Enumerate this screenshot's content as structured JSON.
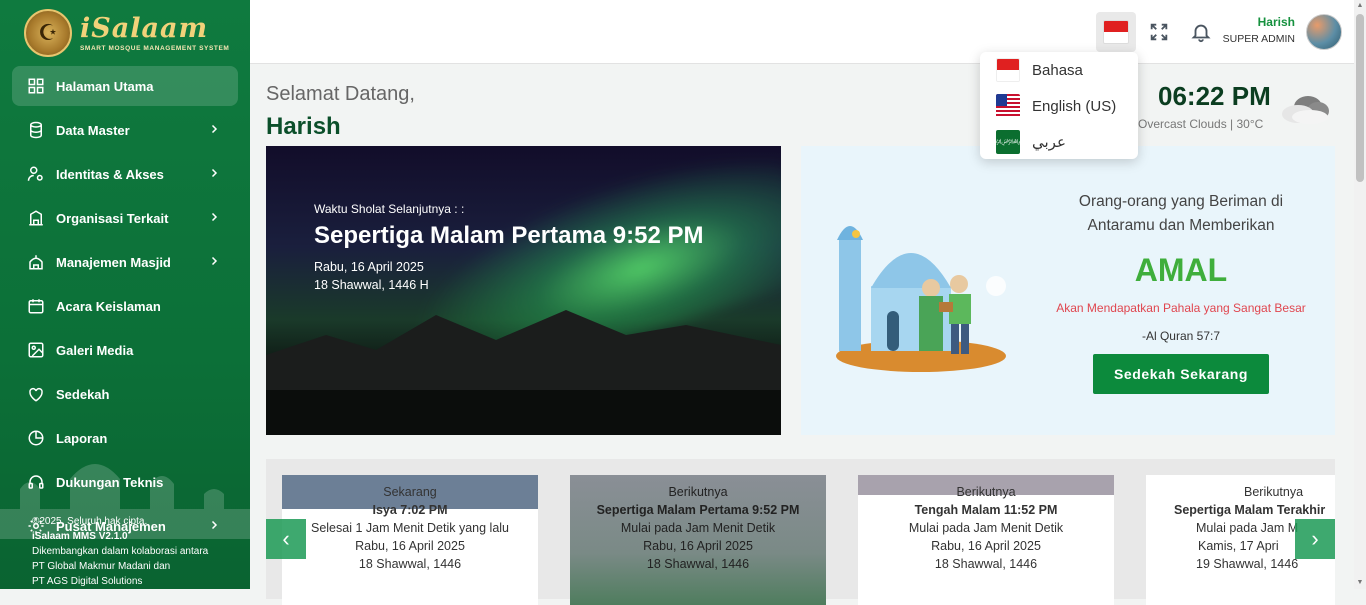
{
  "brand": {
    "title": "iSalaam",
    "subtitle": "SMART MOSQUE MANAGEMENT SYSTEM"
  },
  "sidebar": {
    "items": [
      {
        "label": "Halaman Utama",
        "icon": "grid-icon",
        "chevron": false
      },
      {
        "label": "Data Master",
        "icon": "database-icon",
        "chevron": true
      },
      {
        "label": "Identitas & Akses",
        "icon": "user-settings-icon",
        "chevron": true
      },
      {
        "label": "Organisasi Terkait",
        "icon": "building-icon",
        "chevron": true
      },
      {
        "label": "Manajemen Masjid",
        "icon": "mosque-icon",
        "chevron": true
      },
      {
        "label": "Acara Keislaman",
        "icon": "calendar-icon",
        "chevron": false
      },
      {
        "label": "Galeri Media",
        "icon": "image-icon",
        "chevron": false
      },
      {
        "label": "Sedekah",
        "icon": "heart-icon",
        "chevron": false
      },
      {
        "label": "Laporan",
        "icon": "pie-chart-icon",
        "chevron": false
      },
      {
        "label": "Dukungan Teknis",
        "icon": "headset-icon",
        "chevron": false
      },
      {
        "label": "Pusat Manajemen",
        "icon": "gear-icon",
        "chevron": true
      }
    ],
    "footer": {
      "copyright": "©2025. Seluruh hak cipta.",
      "version": "iSalaam MMS V2.1.0",
      "line1": "Dikembangkan dalam kolaborasi antara",
      "line2": "PT Global Makmur Madani dan",
      "line3": "PT AGS Digital Solutions"
    }
  },
  "header": {
    "user_name": "Harish",
    "user_role": "SUPER ADMIN"
  },
  "language_menu": {
    "items": [
      {
        "label": "Bahasa",
        "flag": "indonesia-flag-icon"
      },
      {
        "label": "English (US)",
        "flag": "us-flag-icon"
      },
      {
        "label": "عربي",
        "flag": "saudi-flag-icon"
      }
    ]
  },
  "welcome": {
    "greeting": "Selamat Datang,",
    "name": "Harish"
  },
  "clock": {
    "time": "06:22 PM",
    "weather": "Overcast Clouds | 30°C"
  },
  "hero": {
    "label": "Waktu Sholat Selanjutnya : :",
    "prayer": "Sepertiga Malam Pertama 9:52 PM",
    "date": "Rabu, 16 April 2025",
    "hijri": "18 Shawwal, 1446 H"
  },
  "promo": {
    "line1": "Orang-orang yang Beriman di",
    "line2": "Antaramu dan Memberikan",
    "highlight": "AMAL",
    "reward": "Akan Mendapatkan Pahala yang Sangat Besar",
    "source": "-Al Quran 57:7",
    "button": "Sedekah Sekarang"
  },
  "prayer_cards": [
    {
      "status": "Sekarang",
      "name": "Isya 7:02 PM",
      "relative": "Selesai 1 Jam Menit Detik yang lalu",
      "date": "Rabu, 16 April 2025",
      "hijri": "18 Shawwal, 1446"
    },
    {
      "status": "Berikutnya",
      "name": "Sepertiga Malam Pertama 9:52 PM",
      "relative": "Mulai pada Jam Menit Detik",
      "date": "Rabu, 16 April 2025",
      "hijri": "18 Shawwal, 1446"
    },
    {
      "status": "Berikutnya",
      "name": "Tengah Malam 11:52 PM",
      "relative": "Mulai pada Jam Menit Detik",
      "date": "Rabu, 16 April 2025",
      "hijri": "18 Shawwal, 1446"
    },
    {
      "status": "Berikutnya",
      "name": "Sepertiga Malam Terakhir",
      "relative": "Mulai pada Jam M",
      "date": "Kamis, 17 Apri",
      "hijri": "19 Shawwal, 1446"
    }
  ],
  "colors": {
    "brand_green": "#0f7a3f",
    "accent_green": "#3fae3c",
    "button_green": "#0c8a3c",
    "reward_red": "#e0464f"
  }
}
